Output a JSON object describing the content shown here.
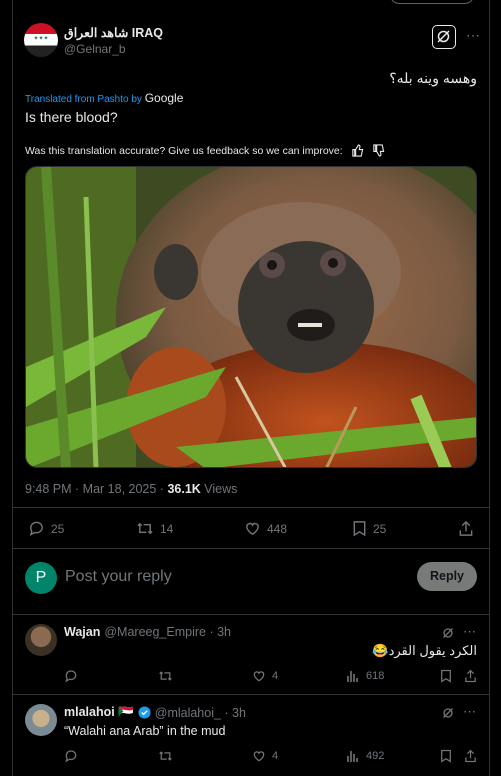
{
  "top_partial_button": "",
  "tweet": {
    "display_name": "شاهد العراق IRAQ",
    "handle": "@Gelnar_b",
    "text": "وهسه وينه بله؟",
    "translated_from": "Translated from Pashto by",
    "translator": "Google",
    "translation": "Is there blood?",
    "feedback_question": "Was this translation accurate? Give us feedback so we can improve:",
    "time": "9:48 PM · Mar 18, 2025 · ",
    "views_count": "36.1K",
    "views_label": " Views",
    "stats": {
      "replies": "25",
      "retweets": "14",
      "likes": "448",
      "bookmarks": "25"
    },
    "image_alt": "Monkey with red-brown fur staring among grass"
  },
  "composer": {
    "avatar_letter": "P",
    "placeholder": "Post your reply",
    "reply_button": "Reply"
  },
  "replies": [
    {
      "name": "Wajan",
      "handle": "@Mareeg_Empire · 3h",
      "text": "الكرد يقول القرد😂",
      "stats": {
        "likes": "4",
        "views": "618"
      }
    },
    {
      "name": "mlalahoi 🇸🇩",
      "handle": "@mlalahoi_ · 3h",
      "text": "“Walahi ana Arab” in the mud",
      "stats": {
        "likes": "4",
        "views": "492"
      }
    }
  ],
  "colors": {
    "accent": "#1d9bf0",
    "composer_avatar": "#00856a",
    "background": "#000000",
    "border": "#2f3336"
  }
}
